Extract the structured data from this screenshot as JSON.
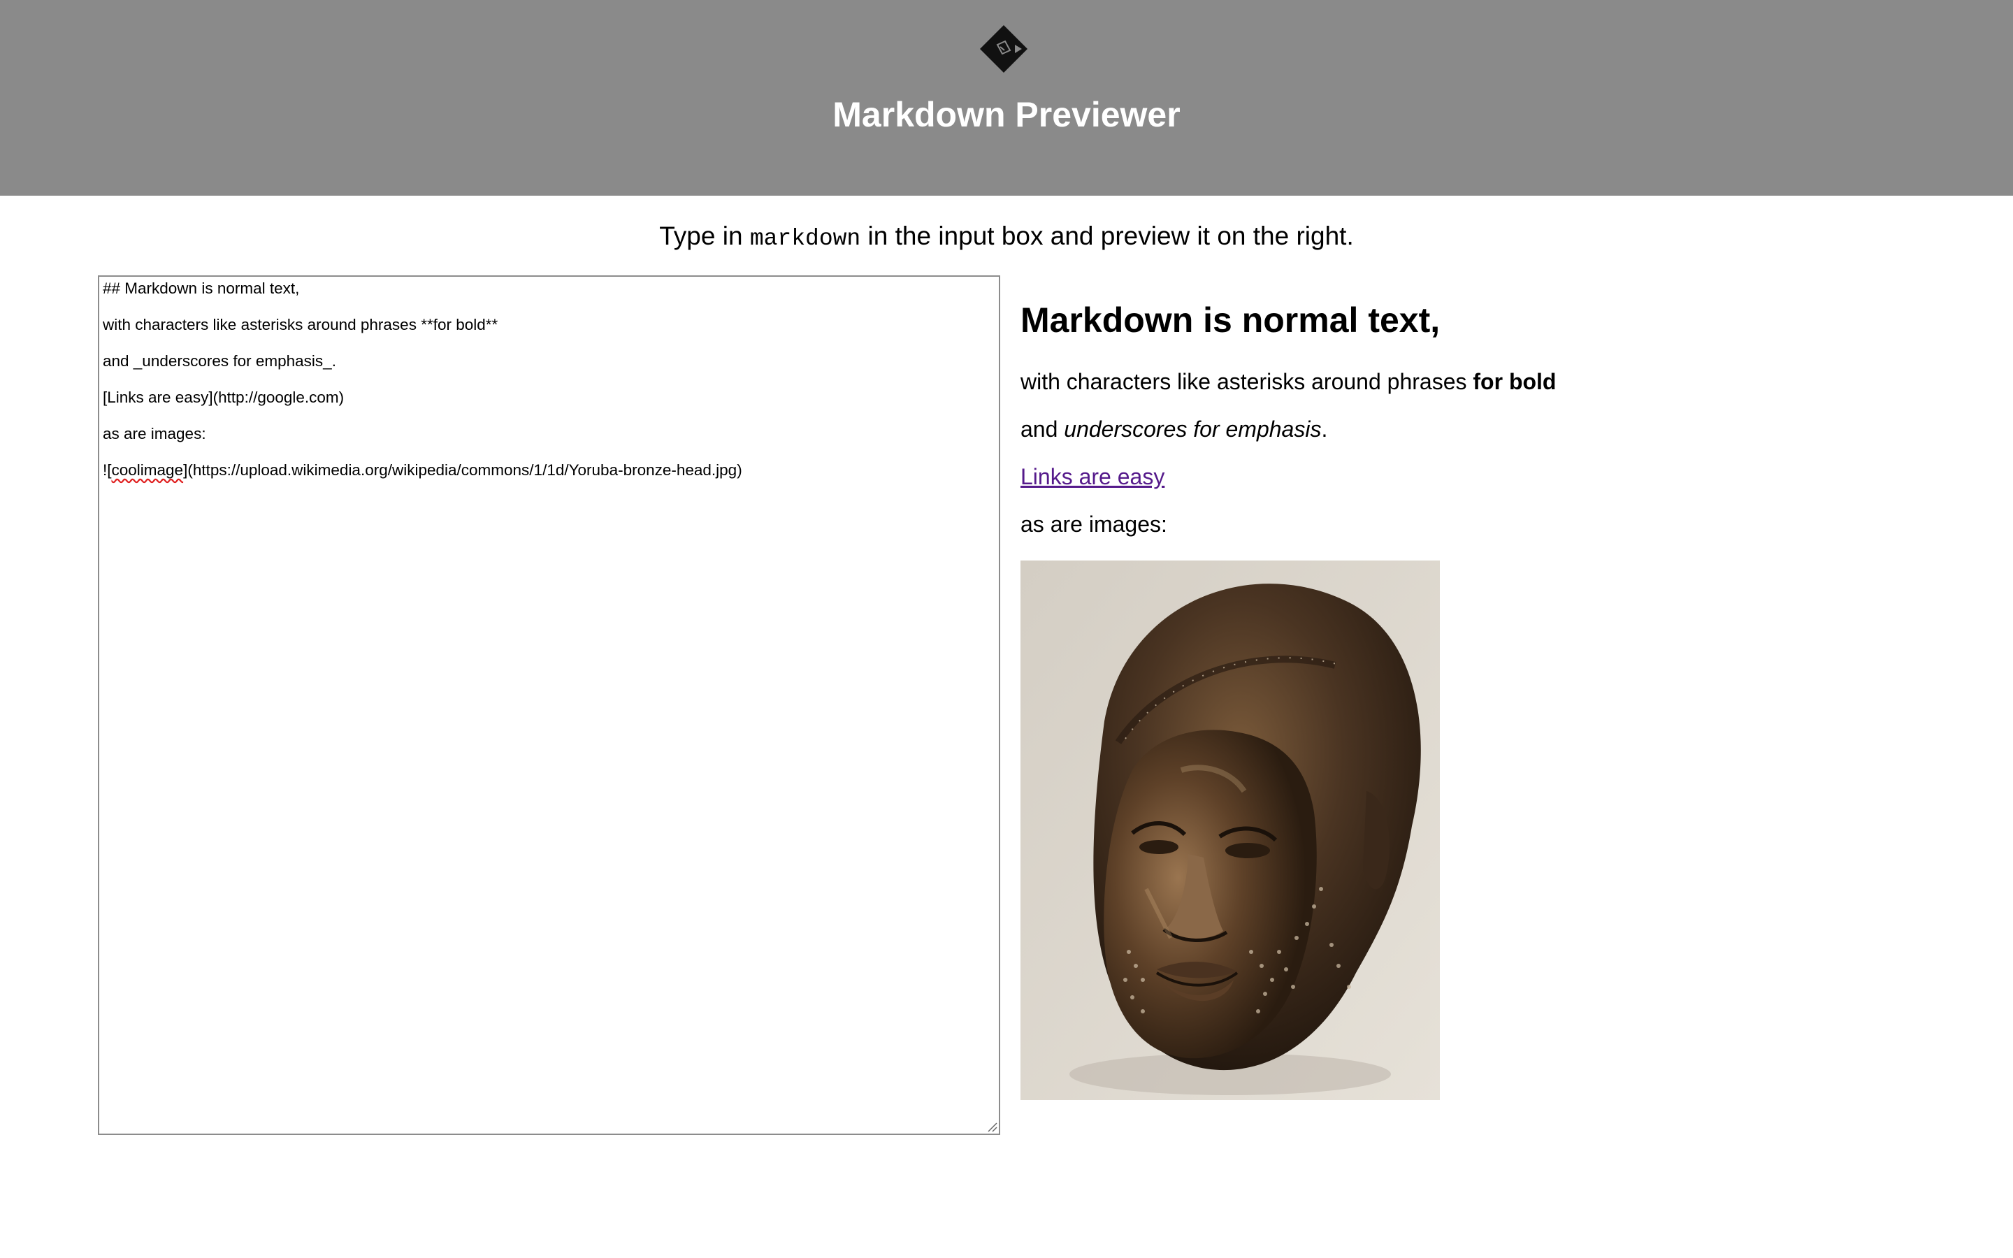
{
  "header": {
    "logo_icon": "markdown-diamond-logo-icon",
    "title": "Markdown Previewer",
    "background": "#8a8a8a"
  },
  "intro": {
    "before": "Type in ",
    "code": "markdown",
    "after": " in the input box and preview it on the right."
  },
  "editor": {
    "lines": [
      "## Markdown is normal text,",
      "with characters like asterisks around phrases **for bold**",
      "and _underscores for emphasis_.",
      "[Links are easy](http://google.com)",
      "as are images:",
      "![coolimage](https://upload.wikimedia.org/wikipedia/commons/1/1d/Yoruba-bronze-head.jpg)"
    ],
    "last_line_parts": {
      "prefix": "![",
      "misspelled": "coolimage",
      "suffix": "](https://upload.wikimedia.org/wikipedia/commons/1/1d/Yoruba-bronze-head.jpg)"
    }
  },
  "preview": {
    "heading": "Markdown is normal text,",
    "p1_text": "with characters like asterisks around phrases ",
    "p1_bold": "for bold",
    "p2_before": "and ",
    "p2_em": "underscores for emphasis",
    "p2_after": ".",
    "link_text": "Links are easy",
    "link_color": "#551a8b",
    "p4_text": "as are images:",
    "image": {
      "alt": "coolimage",
      "subject": "yoruba-bronze-head"
    }
  }
}
